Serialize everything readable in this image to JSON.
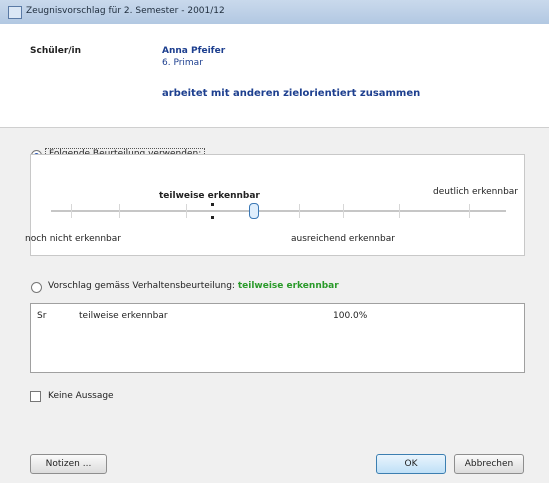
{
  "window": {
    "title": "Zeugnisvorschlag für 2. Semester - 2001/12"
  },
  "header": {
    "student_label": "Schüler/in",
    "student_name": "Anna Pfeifer",
    "student_class": "6. Primar",
    "criterion": "arbeitet mit anderen zielorientiert zusammen"
  },
  "assessment": {
    "option_manual": "Folgende Beurteilung verwenden:",
    "current_value_label": "teilweise erkennbar",
    "level_labels": [
      "noch nicht erkennbar",
      "ausreichend erkennbar",
      "deutlich erkennbar"
    ],
    "option_suggestion": "Vorschlag gemäss Verhaltensbeurteilung:",
    "suggestion_value": "teilweise erkennbar"
  },
  "suggestion_list": {
    "rows": [
      {
        "code": "Sr",
        "value": "teilweise erkennbar",
        "percent": "100.0%"
      }
    ]
  },
  "no_statement": {
    "label": "Keine Aussage"
  },
  "buttons": {
    "help": "Notizen ...",
    "ok": "OK",
    "cancel": "Abbrechen"
  }
}
